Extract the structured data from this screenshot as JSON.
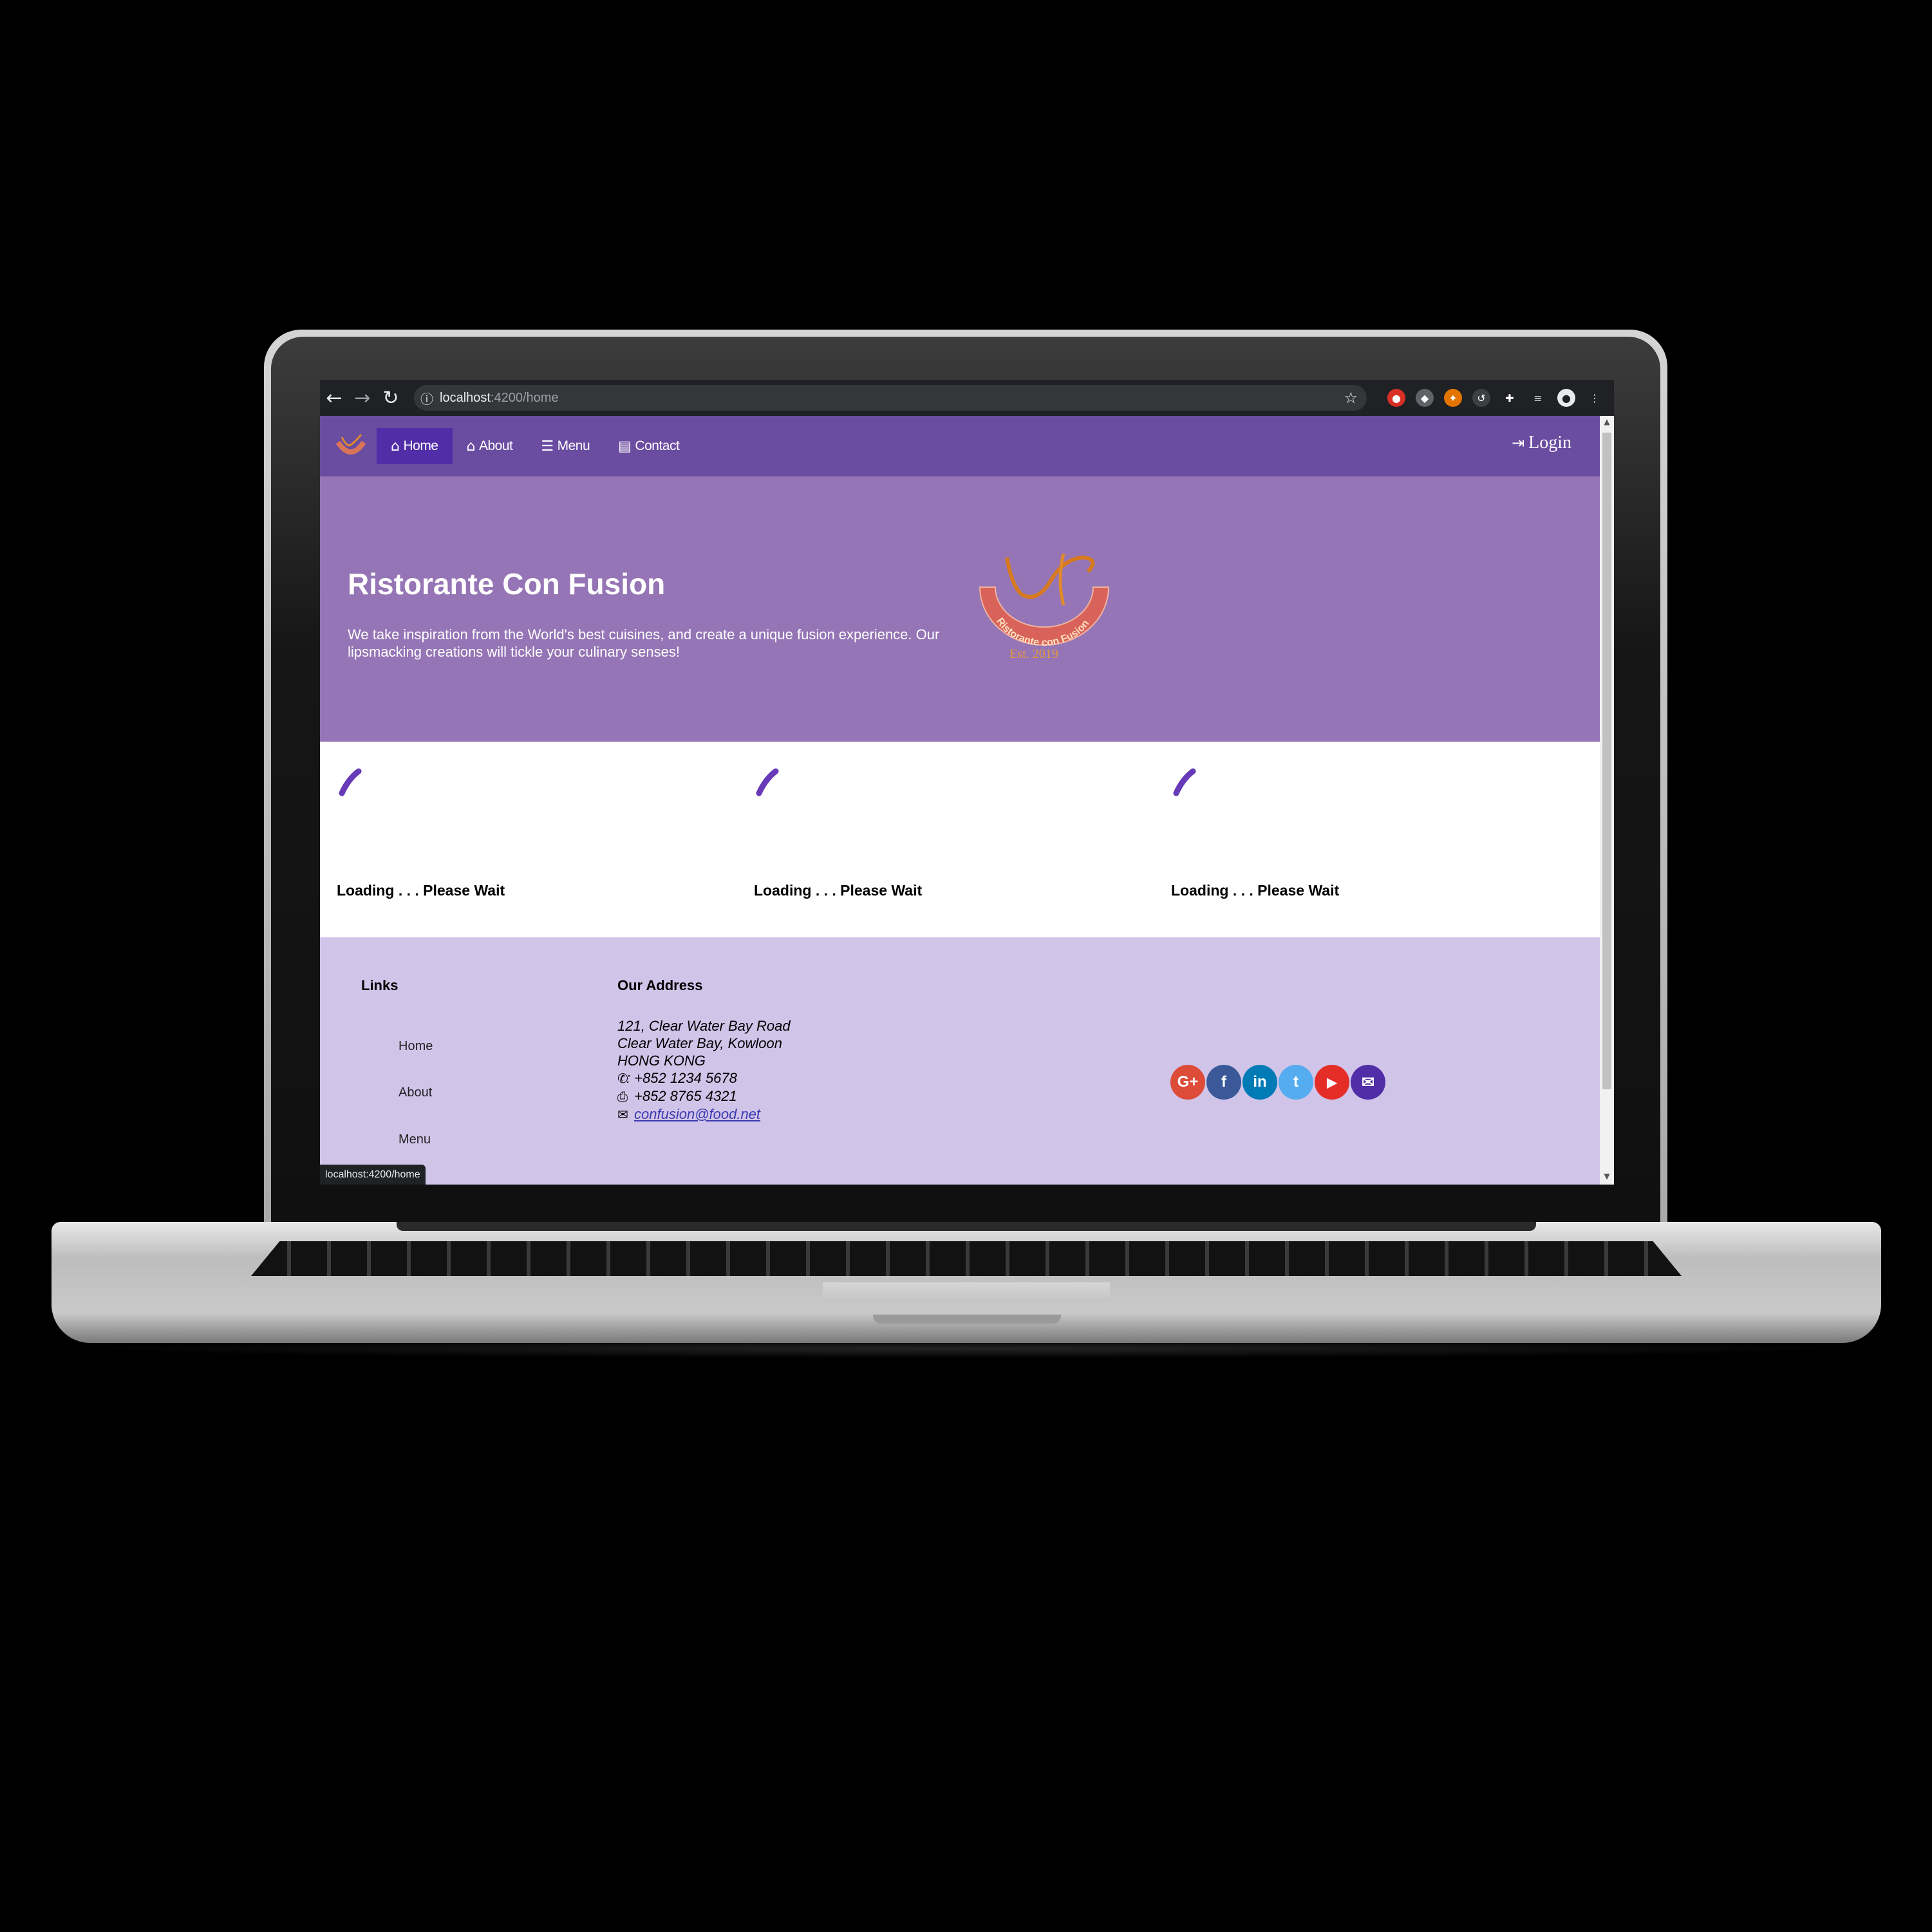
{
  "browser": {
    "url_host": "localhost",
    "url_path": ":4200/home",
    "status_url": "localhost:4200/home"
  },
  "navbar": {
    "items": [
      {
        "label": "Home",
        "icon": "home-icon",
        "active": true
      },
      {
        "label": "About",
        "icon": "info-home-icon",
        "active": false
      },
      {
        "label": "Menu",
        "icon": "list-icon",
        "active": false
      },
      {
        "label": "Contact",
        "icon": "address-card-icon",
        "active": false
      }
    ],
    "login_label": "Login"
  },
  "jumbotron": {
    "title": "Ristorante Con Fusion",
    "text": "We take inspiration from the World's best cuisines, and create a unique fusion experience. Our lipsmacking creations will tickle your culinary senses!",
    "logo_text": "Ristorante con Fusion",
    "logo_est": "Est. 2019"
  },
  "cards": [
    {
      "text": "Loading . . . Please Wait"
    },
    {
      "text": "Loading . . . Please Wait"
    },
    {
      "text": "Loading . . . Please Wait"
    }
  ],
  "footer": {
    "links_heading": "Links",
    "links": [
      "Home",
      "About",
      "Menu"
    ],
    "address_heading": "Our Address",
    "address_lines": [
      "121, Clear Water Bay Road",
      "Clear Water Bay, Kowloon",
      "HONG KONG"
    ],
    "phone": ": +852 1234 5678",
    "fax": "+852 8765 4321",
    "email": "confusion@food.net",
    "social": [
      {
        "name": "google-plus",
        "glyph": "G+",
        "color": "#dd4b39"
      },
      {
        "name": "facebook",
        "glyph": "f",
        "color": "#3b5998"
      },
      {
        "name": "linkedin",
        "glyph": "in",
        "color": "#007bb6"
      },
      {
        "name": "twitter",
        "glyph": "t",
        "color": "#55acee"
      },
      {
        "name": "youtube",
        "glyph": "▶",
        "color": "#e52d27"
      },
      {
        "name": "email",
        "glyph": "✉",
        "color": "#512da8"
      }
    ]
  },
  "colors": {
    "navbar": "#6a4ca0",
    "jumbotron": "#9575b5",
    "footer": "#d1c4e9",
    "spinner": "#673ab7"
  }
}
